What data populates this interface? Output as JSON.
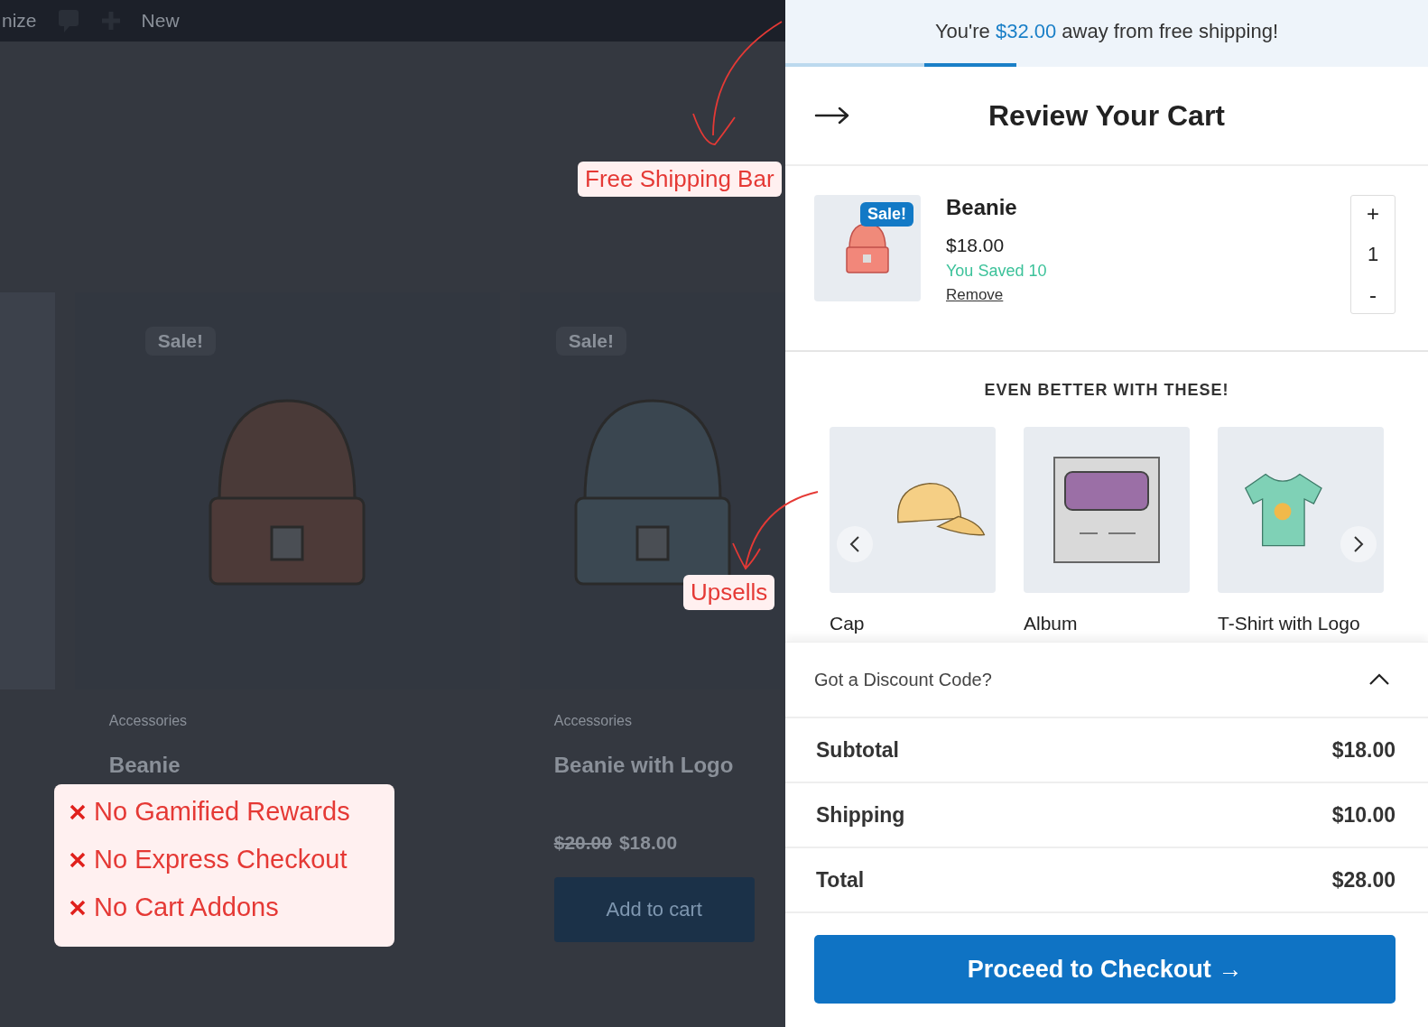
{
  "background_page": {
    "toolbar": {
      "site_label": "nize",
      "new_label": "New"
    },
    "products": [
      {
        "badge": "Sale!",
        "category": "Accessories",
        "name": "Beanie"
      },
      {
        "badge": "Sale!",
        "category": "Accessories",
        "name": "Beanie with Logo",
        "old_price": "$20.00",
        "price": "$18.00",
        "button": "Add to cart"
      }
    ]
  },
  "annotations": [
    {
      "kind": "callout",
      "label": "Free Shipping Bar"
    },
    {
      "kind": "callout",
      "label": "Upsells"
    }
  ],
  "missing_features": [
    "No Gamified Rewards",
    "No Express Checkout",
    "No Cart Addons"
  ],
  "cart": {
    "shipping_bar": {
      "before": "You're ",
      "amount": "$32.00",
      "after": " away from free shipping!",
      "level": 0.36
    },
    "title": "Review Your Cart",
    "items": [
      {
        "badge": "Sale!",
        "name": "Beanie",
        "price": "$18.00",
        "saved": "You Saved 10",
        "remove": "Remove",
        "quantity": "1",
        "plus": "+",
        "minus": "-"
      }
    ],
    "upsells": {
      "heading": "EVEN BETTER WITH THESE!",
      "products": [
        {
          "kind": "cap",
          "name": "Cap"
        },
        {
          "kind": "album",
          "name": "Album"
        },
        {
          "kind": "tshirt",
          "name": "T-Shirt with Logo"
        }
      ]
    },
    "discount": {
      "label": "Got a Discount Code?",
      "expanded": true
    },
    "totals": [
      {
        "label": "Subtotal",
        "value": "$18.00"
      },
      {
        "label": "Shipping",
        "value": "$10.00"
      },
      {
        "label": "Total",
        "value": "$28.00"
      }
    ],
    "checkout_button": "Proceed to Checkout →"
  }
}
